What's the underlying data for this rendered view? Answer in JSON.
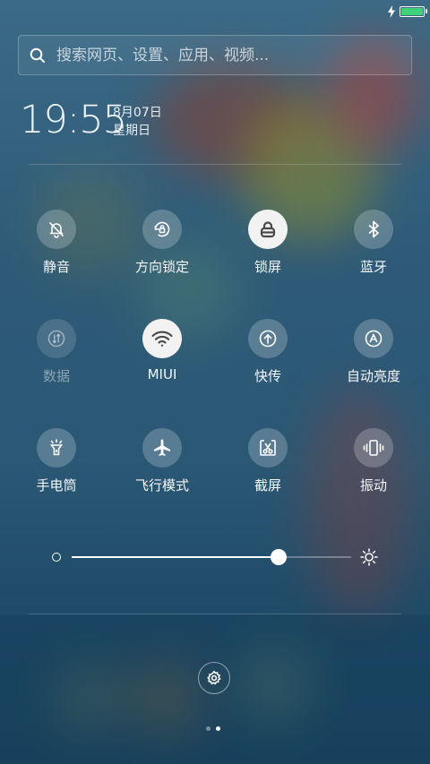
{
  "status": {
    "icons": [
      "charging-bolt-icon",
      "battery-icon"
    ],
    "battery_level": 1.0
  },
  "search": {
    "placeholder": "搜索网页、设置、应用、视频..."
  },
  "clock": {
    "time": "19:55",
    "date": "8月07日",
    "weekday": "星期日"
  },
  "toggles": [
    {
      "label": "静音",
      "icon": "bell-off-icon",
      "state": "off"
    },
    {
      "label": "方向锁定",
      "icon": "rotation-lock-icon",
      "state": "off"
    },
    {
      "label": "锁屏",
      "icon": "lock-icon",
      "state": "on"
    },
    {
      "label": "蓝牙",
      "icon": "bluetooth-icon",
      "state": "off"
    },
    {
      "label": "数据",
      "icon": "mobile-data-icon",
      "state": "disabled"
    },
    {
      "label": "MIUI",
      "icon": "wifi-icon",
      "state": "on"
    },
    {
      "label": "快传",
      "icon": "quick-transfer-icon",
      "state": "off"
    },
    {
      "label": "自动亮度",
      "icon": "auto-brightness-icon",
      "state": "off"
    },
    {
      "label": "手电筒",
      "icon": "flashlight-icon",
      "state": "off"
    },
    {
      "label": "飞行模式",
      "icon": "airplane-icon",
      "state": "off"
    },
    {
      "label": "截屏",
      "icon": "screenshot-icon",
      "state": "off"
    },
    {
      "label": "振动",
      "icon": "vibrate-icon",
      "state": "off"
    }
  ],
  "brightness": {
    "level": 0.74,
    "min_icon": "brightness-low-icon",
    "max_icon": "brightness-high-icon"
  },
  "footer": {
    "settings_icon": "gear-icon",
    "pages": 2,
    "active_page": 2
  },
  "colors": {
    "toggle_on": "#f2f2f2",
    "battery": "#3ed27a"
  }
}
